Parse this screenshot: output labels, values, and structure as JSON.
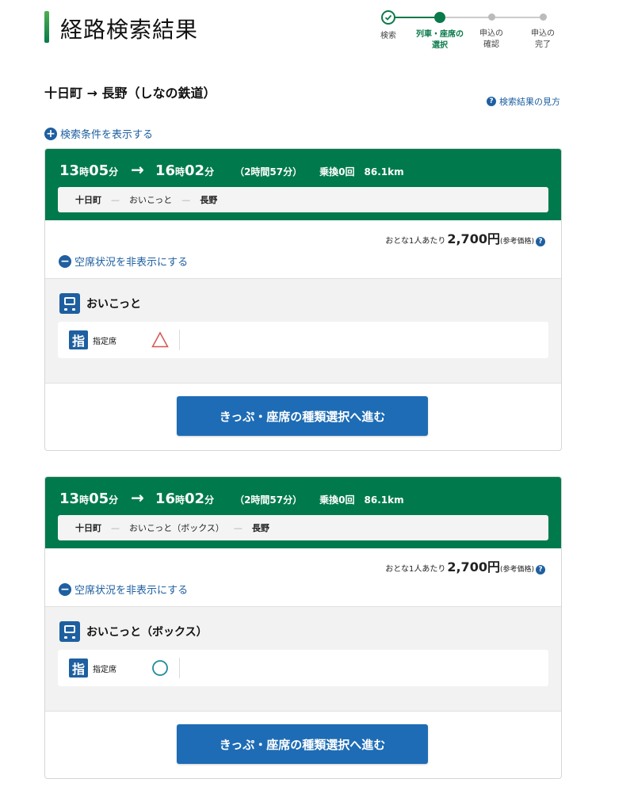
{
  "page": {
    "title": "経路検索結果"
  },
  "steps": [
    {
      "label1": "検索",
      "label2": "",
      "state": "done"
    },
    {
      "label1": "列車・座席の",
      "label2": "選択",
      "state": "active"
    },
    {
      "label1": "申込の",
      "label2": "確認",
      "state": "todo"
    },
    {
      "label1": "申込の",
      "label2": "完了",
      "state": "todo"
    }
  ],
  "route": {
    "text": "十日町 → 長野（しなの鉄道）"
  },
  "howto": {
    "label": "検索結果の見方"
  },
  "search_conditions": {
    "label": "検索条件を表示する"
  },
  "results": [
    {
      "dep_h": "13",
      "dep_m": "05",
      "arr_h": "16",
      "arr_m": "02",
      "hour_unit": "時",
      "min_unit": "分",
      "duration": "（2時間57分）",
      "transfers": "乗換0回",
      "distance": "86.1km",
      "segment": {
        "from": "十日町",
        "train": "おいこっと",
        "to": "長野"
      },
      "price": {
        "prefix": "おとな1人あたり",
        "amount": "2,700円",
        "note": "(参考価格)"
      },
      "toggle_label": "空席状況を非表示にする",
      "train_name": "おいこっと",
      "seat": {
        "icon_char": "指",
        "type": "指定席",
        "status": "triangle"
      },
      "button_label": "きっぷ・座席の種類選択へ進む"
    },
    {
      "dep_h": "13",
      "dep_m": "05",
      "arr_h": "16",
      "arr_m": "02",
      "hour_unit": "時",
      "min_unit": "分",
      "duration": "（2時間57分）",
      "transfers": "乗換0回",
      "distance": "86.1km",
      "segment": {
        "from": "十日町",
        "train": "おいこっと（ボックス）",
        "to": "長野"
      },
      "price": {
        "prefix": "おとな1人あたり",
        "amount": "2,700円",
        "note": "(参考価格)"
      },
      "toggle_label": "空席状況を非表示にする",
      "train_name": "おいこっと（ボックス）",
      "seat": {
        "icon_char": "指",
        "type": "指定席",
        "status": "circle"
      },
      "button_label": "きっぷ・座席の種類選択へ進む"
    }
  ],
  "colors": {
    "green": "#007a4c",
    "blue": "#1e6cb5",
    "triangle": "#d9534f",
    "circle": "#1f8a9a"
  }
}
